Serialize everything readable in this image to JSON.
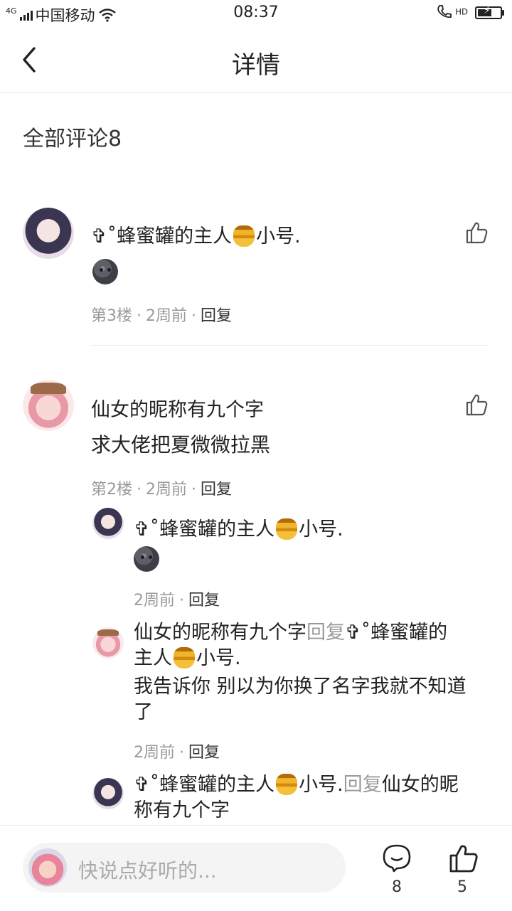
{
  "status": {
    "network": "4G",
    "carrier": "中国移动",
    "time": "08:37",
    "hd": "HD"
  },
  "header": {
    "title": "详情"
  },
  "section_title": "全部评论8",
  "comments": [
    {
      "name_prefix": "✞˚蜂蜜罐的主人",
      "name_suffix": "小号.",
      "meta_floor": "第3楼",
      "meta_time": "2周前",
      "reply": "回复"
    },
    {
      "name": "仙女的昵称有九个字",
      "text": "求大佬把夏微微拉黑",
      "meta_floor": "第2楼",
      "meta_time": "2周前",
      "reply": "回复",
      "replies": [
        {
          "name_prefix": "✞˚蜂蜜罐的主人",
          "name_suffix": "小号.",
          "meta_time": "2周前",
          "reply": "回复"
        },
        {
          "from": "仙女的昵称有九个字",
          "reply_word": "回复",
          "to_prefix": "✞˚蜂蜜罐的",
          "to_line2_prefix": "主人",
          "to_suffix": "小号.",
          "text": "我告诉你 别以为你换了名字我就不知道了",
          "meta_time": "2周前",
          "reply": "回复"
        },
        {
          "from_prefix": "✞˚蜂蜜罐的主人",
          "from_suffix": "小号.",
          "reply_word": "回复",
          "to_line1": "仙女的昵",
          "to_line2": "称有九个字"
        }
      ]
    }
  ],
  "bottom": {
    "placeholder": "快说点好听的...",
    "comment_count": "8",
    "like_count": "5"
  }
}
